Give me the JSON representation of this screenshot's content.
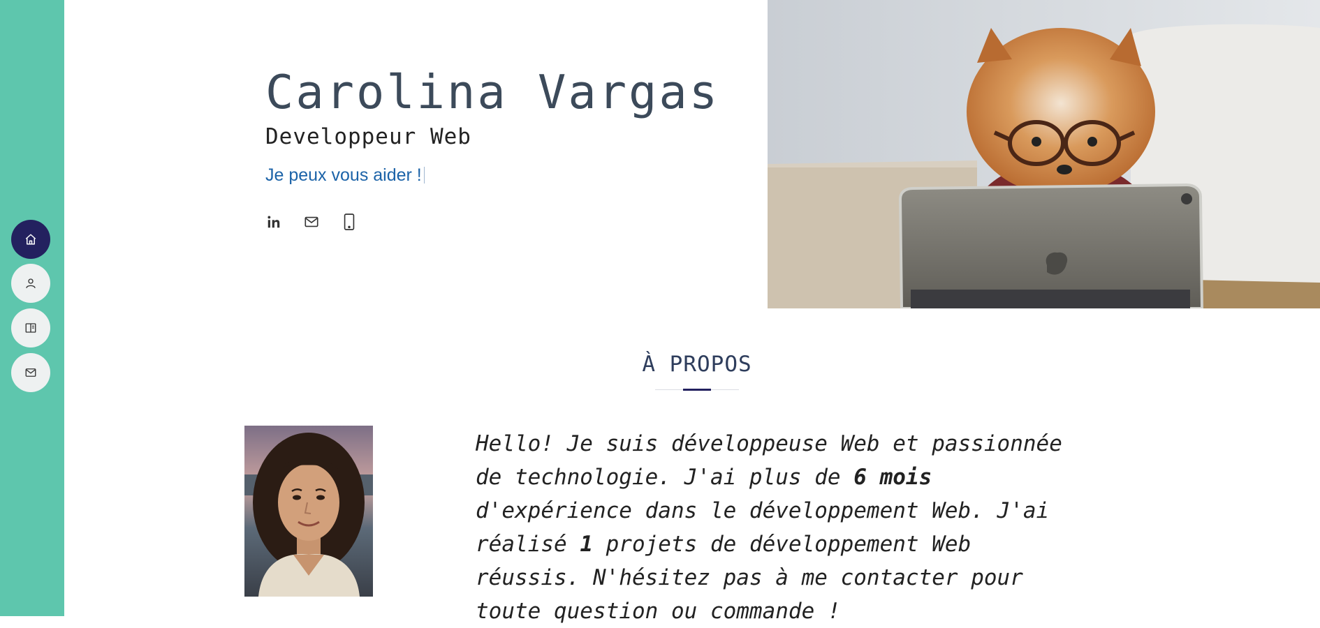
{
  "sidebar": {
    "items": [
      {
        "name": "home",
        "icon": "home-icon",
        "active": true
      },
      {
        "name": "about",
        "icon": "user-icon",
        "active": false
      },
      {
        "name": "portfolio",
        "icon": "book-icon",
        "active": false
      },
      {
        "name": "contact",
        "icon": "mail-icon",
        "active": false
      }
    ],
    "colors": {
      "background": "#5ec6ad",
      "active": "#23215f",
      "inactive": "#eef1f1"
    }
  },
  "hero": {
    "name": "Carolina Vargas",
    "role": "Developpeur Web",
    "tagline": "Je peux vous aider !",
    "socials": [
      {
        "icon": "linkedin-icon"
      },
      {
        "icon": "mail-icon"
      },
      {
        "icon": "phone-icon"
      }
    ],
    "image": "photo-of-pomeranian-dog-wearing-glasses-in-front-of-tablet"
  },
  "about": {
    "title": "À PROPOS",
    "portrait": "portrait-photo-of-woman-with-curly-hair",
    "text": {
      "p1": "Hello! Je suis développeuse Web et passionnée de technologie. J'ai plus de ",
      "experience": "6 mois",
      "p2": " d'expérience dans le développement Web. J'ai réalisé ",
      "projects": "1",
      "p3": " projets de développement Web réussis. N'hésitez pas à me contacter pour toute question ou commande !"
    }
  },
  "colors": {
    "accent": "#23215f",
    "title": "#3c4a5a",
    "link": "#1c63a8"
  }
}
